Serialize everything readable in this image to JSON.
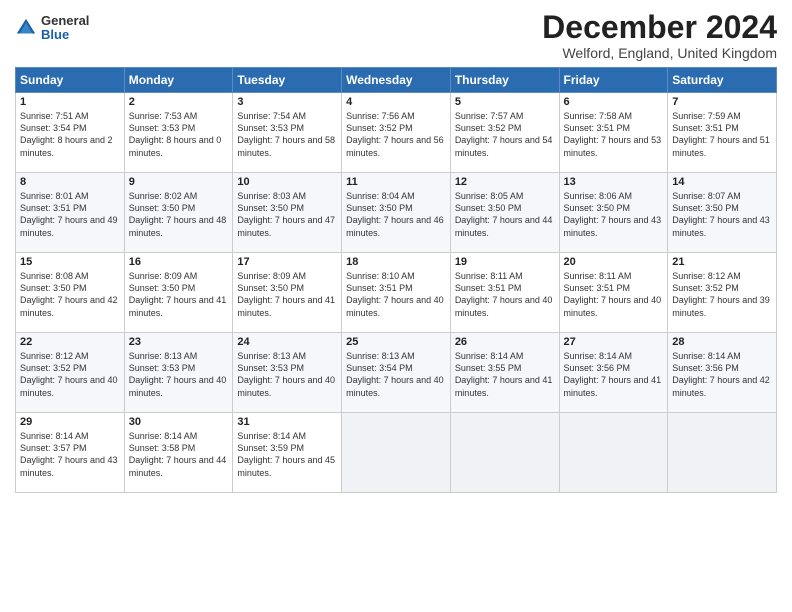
{
  "logo": {
    "general": "General",
    "blue": "Blue"
  },
  "title": "December 2024",
  "subtitle": "Welford, England, United Kingdom",
  "weekdays": [
    "Sunday",
    "Monday",
    "Tuesday",
    "Wednesday",
    "Thursday",
    "Friday",
    "Saturday"
  ],
  "weeks": [
    [
      {
        "day": "1",
        "sunrise": "7:51 AM",
        "sunset": "3:54 PM",
        "daylight": "8 hours and 2 minutes."
      },
      {
        "day": "2",
        "sunrise": "7:53 AM",
        "sunset": "3:53 PM",
        "daylight": "8 hours and 0 minutes."
      },
      {
        "day": "3",
        "sunrise": "7:54 AM",
        "sunset": "3:53 PM",
        "daylight": "7 hours and 58 minutes."
      },
      {
        "day": "4",
        "sunrise": "7:56 AM",
        "sunset": "3:52 PM",
        "daylight": "7 hours and 56 minutes."
      },
      {
        "day": "5",
        "sunrise": "7:57 AM",
        "sunset": "3:52 PM",
        "daylight": "7 hours and 54 minutes."
      },
      {
        "day": "6",
        "sunrise": "7:58 AM",
        "sunset": "3:51 PM",
        "daylight": "7 hours and 53 minutes."
      },
      {
        "day": "7",
        "sunrise": "7:59 AM",
        "sunset": "3:51 PM",
        "daylight": "7 hours and 51 minutes."
      }
    ],
    [
      {
        "day": "8",
        "sunrise": "8:01 AM",
        "sunset": "3:51 PM",
        "daylight": "7 hours and 49 minutes."
      },
      {
        "day": "9",
        "sunrise": "8:02 AM",
        "sunset": "3:50 PM",
        "daylight": "7 hours and 48 minutes."
      },
      {
        "day": "10",
        "sunrise": "8:03 AM",
        "sunset": "3:50 PM",
        "daylight": "7 hours and 47 minutes."
      },
      {
        "day": "11",
        "sunrise": "8:04 AM",
        "sunset": "3:50 PM",
        "daylight": "7 hours and 46 minutes."
      },
      {
        "day": "12",
        "sunrise": "8:05 AM",
        "sunset": "3:50 PM",
        "daylight": "7 hours and 44 minutes."
      },
      {
        "day": "13",
        "sunrise": "8:06 AM",
        "sunset": "3:50 PM",
        "daylight": "7 hours and 43 minutes."
      },
      {
        "day": "14",
        "sunrise": "8:07 AM",
        "sunset": "3:50 PM",
        "daylight": "7 hours and 43 minutes."
      }
    ],
    [
      {
        "day": "15",
        "sunrise": "8:08 AM",
        "sunset": "3:50 PM",
        "daylight": "7 hours and 42 minutes."
      },
      {
        "day": "16",
        "sunrise": "8:09 AM",
        "sunset": "3:50 PM",
        "daylight": "7 hours and 41 minutes."
      },
      {
        "day": "17",
        "sunrise": "8:09 AM",
        "sunset": "3:50 PM",
        "daylight": "7 hours and 41 minutes."
      },
      {
        "day": "18",
        "sunrise": "8:10 AM",
        "sunset": "3:51 PM",
        "daylight": "7 hours and 40 minutes."
      },
      {
        "day": "19",
        "sunrise": "8:11 AM",
        "sunset": "3:51 PM",
        "daylight": "7 hours and 40 minutes."
      },
      {
        "day": "20",
        "sunrise": "8:11 AM",
        "sunset": "3:51 PM",
        "daylight": "7 hours and 40 minutes."
      },
      {
        "day": "21",
        "sunrise": "8:12 AM",
        "sunset": "3:52 PM",
        "daylight": "7 hours and 39 minutes."
      }
    ],
    [
      {
        "day": "22",
        "sunrise": "8:12 AM",
        "sunset": "3:52 PM",
        "daylight": "7 hours and 40 minutes."
      },
      {
        "day": "23",
        "sunrise": "8:13 AM",
        "sunset": "3:53 PM",
        "daylight": "7 hours and 40 minutes."
      },
      {
        "day": "24",
        "sunrise": "8:13 AM",
        "sunset": "3:53 PM",
        "daylight": "7 hours and 40 minutes."
      },
      {
        "day": "25",
        "sunrise": "8:13 AM",
        "sunset": "3:54 PM",
        "daylight": "7 hours and 40 minutes."
      },
      {
        "day": "26",
        "sunrise": "8:14 AM",
        "sunset": "3:55 PM",
        "daylight": "7 hours and 41 minutes."
      },
      {
        "day": "27",
        "sunrise": "8:14 AM",
        "sunset": "3:56 PM",
        "daylight": "7 hours and 41 minutes."
      },
      {
        "day": "28",
        "sunrise": "8:14 AM",
        "sunset": "3:56 PM",
        "daylight": "7 hours and 42 minutes."
      }
    ],
    [
      {
        "day": "29",
        "sunrise": "8:14 AM",
        "sunset": "3:57 PM",
        "daylight": "7 hours and 43 minutes."
      },
      {
        "day": "30",
        "sunrise": "8:14 AM",
        "sunset": "3:58 PM",
        "daylight": "7 hours and 44 minutes."
      },
      {
        "day": "31",
        "sunrise": "8:14 AM",
        "sunset": "3:59 PM",
        "daylight": "7 hours and 45 minutes."
      },
      null,
      null,
      null,
      null
    ]
  ]
}
